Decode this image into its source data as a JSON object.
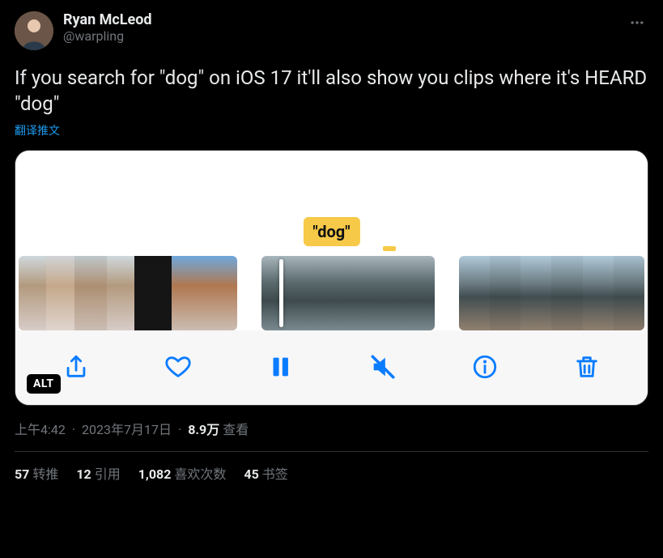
{
  "user": {
    "display_name": "Ryan McLeod",
    "handle": "@warpling"
  },
  "tweet": {
    "text": "If you search for \"dog\" on iOS 17 it'll also show you clips where it's HEARD \"dog\"",
    "translate_label": "翻译推文",
    "media": {
      "tag_text": "\"dog\"",
      "alt_badge": "ALT"
    }
  },
  "meta": {
    "time": "上午4:42",
    "date": "2023年7月17日",
    "views_count": "8.9万",
    "views_label": "查看"
  },
  "stats": {
    "retweets": {
      "count": "57",
      "label": "转推"
    },
    "quotes": {
      "count": "12",
      "label": "引用"
    },
    "likes": {
      "count": "1,082",
      "label": "喜欢次数"
    },
    "bookmarks": {
      "count": "45",
      "label": "书签"
    }
  }
}
